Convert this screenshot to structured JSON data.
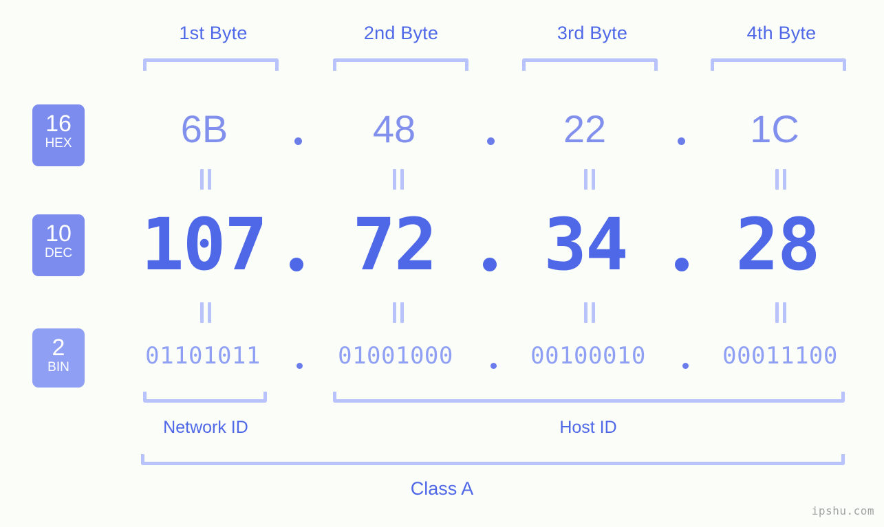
{
  "watermark": "ipshu.com",
  "byte_headers": [
    {
      "label": "1st Byte"
    },
    {
      "label": "2nd Byte"
    },
    {
      "label": "3rd Byte"
    },
    {
      "label": "4th Byte"
    }
  ],
  "bases": [
    {
      "number": "16",
      "abbr": "HEX"
    },
    {
      "number": "10",
      "abbr": "DEC"
    },
    {
      "number": "2",
      "abbr": "BIN"
    }
  ],
  "rows": {
    "hex": {
      "base_number": "16",
      "base_abbr": "HEX",
      "values": [
        "6B",
        "48",
        "22",
        "1C"
      ],
      "separator": "."
    },
    "dec": {
      "base_number": "10",
      "base_abbr": "DEC",
      "values": [
        "107",
        "72",
        "34",
        "28"
      ],
      "separator": "."
    },
    "bin": {
      "base_number": "2",
      "base_abbr": "BIN",
      "values": [
        "01101011",
        "01001000",
        "00100010",
        "00011100"
      ],
      "separator": "."
    }
  },
  "equivalence_marks": {
    "glyph": "=",
    "count_top": 4,
    "count_bottom": 4
  },
  "segments": {
    "network_id": "Network ID",
    "host_id": "Host ID",
    "class": "Class A"
  },
  "colors": {
    "background": "#fbfdf8",
    "accent_strong": "#4f68e8",
    "accent_mid": "#8290ed",
    "accent_light": "#8fa0f4",
    "bracket": "#b9c3fb",
    "badge_solid": "#7b8cee",
    "badge_light": "#8fa0f4",
    "watermark_text": "#a3a3a3"
  }
}
